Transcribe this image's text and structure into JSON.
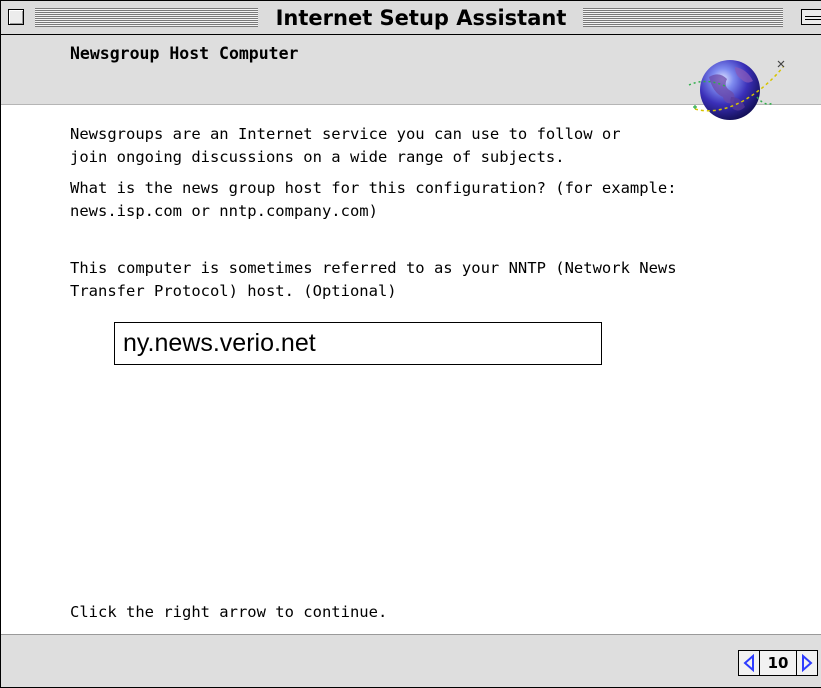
{
  "window": {
    "title": "Internet Setup Assistant"
  },
  "header": {
    "section_title": "Newsgroup Host Computer",
    "icon": "globe-icon"
  },
  "body": {
    "paragraph1": [
      "Newsgroups are an Internet service you can use to follow or",
      "join ongoing discussions on a wide range of subjects."
    ],
    "paragraph2": [
      "What is the news group host for this configuration? (for example:",
      "news.isp.com or nntp.company.com)"
    ],
    "paragraph3": [
      "This computer is sometimes referred to as your NNTP (Network News",
      "Transfer Protocol) host. (Optional)"
    ],
    "host_field_value": "ny.news.verio.net",
    "instruction": "Click the right arrow to continue."
  },
  "footer": {
    "page_number": "10",
    "prev_icon": "left-arrow-icon",
    "next_icon": "right-arrow-icon"
  },
  "colors": {
    "arrow_blue": "#2e3cff",
    "chrome_gray": "#dedede"
  }
}
